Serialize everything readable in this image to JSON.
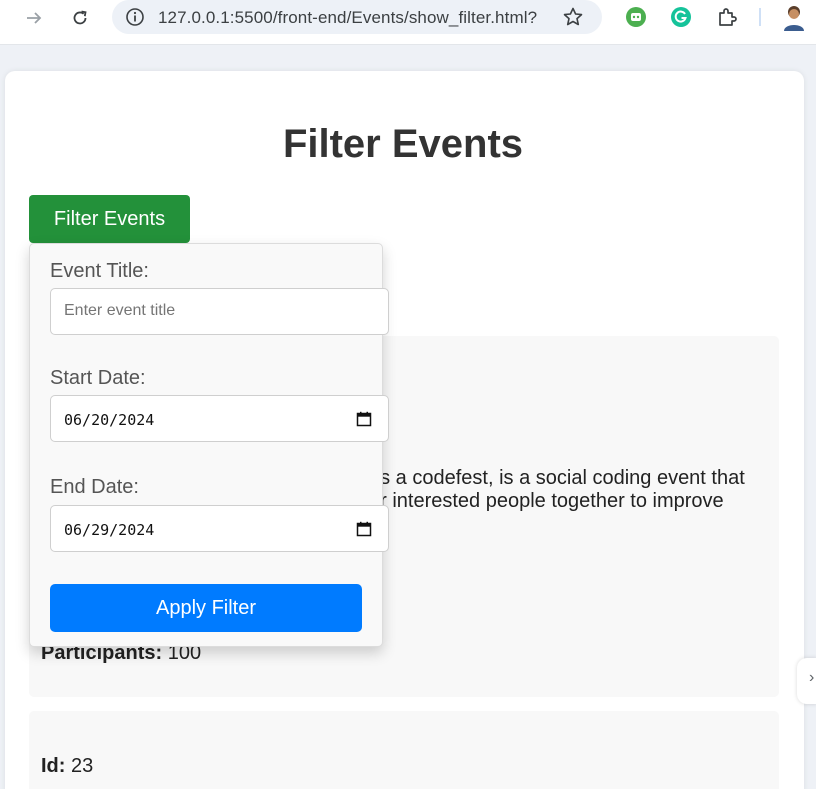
{
  "browser": {
    "url": "127.0.0.1:5500/front-end/Events/show_filter.html?"
  },
  "page": {
    "title": "Filter Events",
    "filter_button_label": "Filter Events"
  },
  "filter_panel": {
    "title_label": "Event Title:",
    "title_placeholder": "Enter event title",
    "start_label": "Start Date:",
    "start_value": "06/20/2024",
    "end_label": "End Date:",
    "end_value": "06/29/2024",
    "apply_label": "Apply Filter"
  },
  "events": [
    {
      "description_lines": [
        "as a codefest, is a social coding event that",
        "er interested people together to improve"
      ],
      "participants_label": "Participants:",
      "participants_value": "100"
    },
    {
      "id_label": "Id:",
      "id_value": "23"
    }
  ],
  "colors": {
    "filter_button": "#23913a",
    "apply_button": "#007bff"
  }
}
